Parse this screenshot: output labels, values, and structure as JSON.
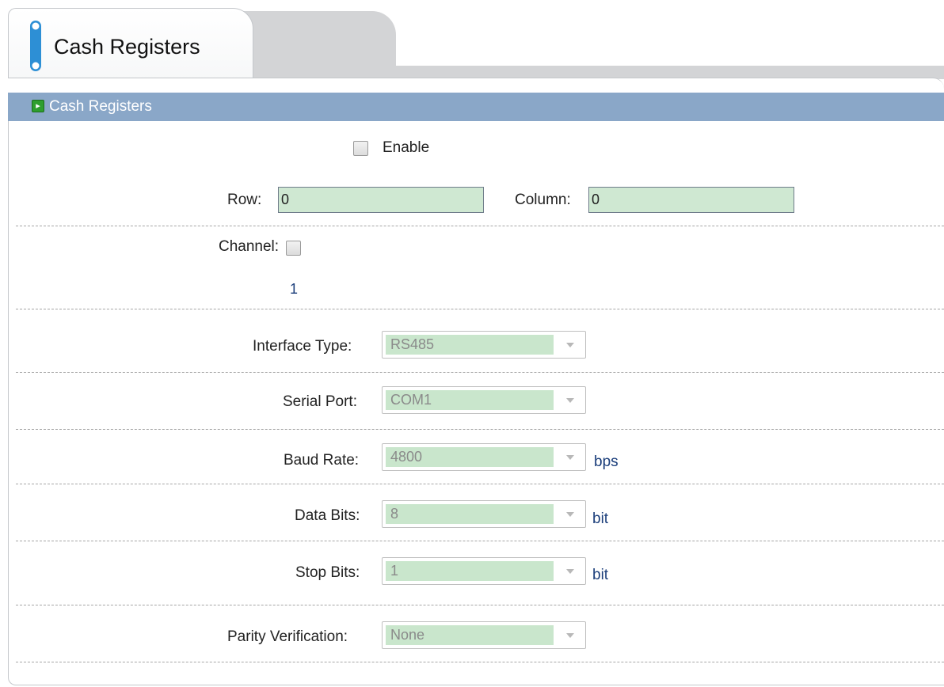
{
  "tab": {
    "title": "Cash Registers"
  },
  "section": {
    "title": "Cash Registers"
  },
  "enable": {
    "label": "Enable",
    "checked": false
  },
  "row": {
    "label": "Row:",
    "value": "0"
  },
  "column": {
    "label": "Column:",
    "value": "0"
  },
  "channel": {
    "label": "Channel:",
    "numbers": [
      "1"
    ]
  },
  "fields": {
    "interface_type": {
      "label": "Interface Type:",
      "value": "RS485"
    },
    "serial_port": {
      "label": "Serial Port:",
      "value": "COM1"
    },
    "baud_rate": {
      "label": "Baud Rate:",
      "value": "4800",
      "unit": "bps"
    },
    "data_bits": {
      "label": "Data Bits:",
      "value": "8",
      "unit": "bit"
    },
    "stop_bits": {
      "label": "Stop Bits:",
      "value": "1",
      "unit": "bit"
    },
    "parity": {
      "label": "Parity Verification:",
      "value": "None"
    }
  },
  "colors": {
    "header_bar": "#8aa7c8",
    "input_fill": "#cfe8d2",
    "unit_text": "#1a3d7a",
    "tab_icon": "#2d8fd5"
  }
}
